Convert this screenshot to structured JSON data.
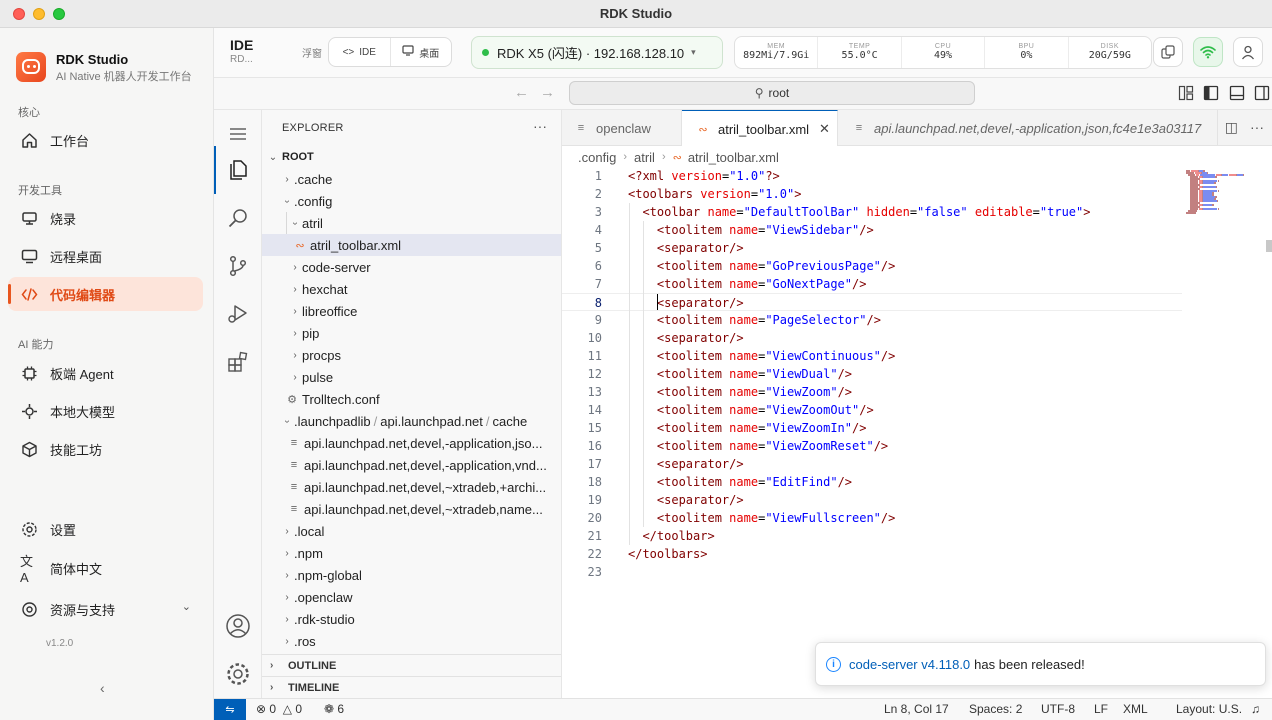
{
  "window": {
    "title": "RDK Studio"
  },
  "app": {
    "name": "RDK Studio",
    "subtitle": "AI Native 机器人开发工作台",
    "version": "v1.2.0"
  },
  "sidebar": {
    "sections": {
      "core": "核心",
      "dev_tools": "开发工具",
      "ai": "AI 能力"
    },
    "items": [
      {
        "label": "工作台",
        "icon": "home-icon"
      },
      {
        "label": "烧录",
        "icon": "flash-icon"
      },
      {
        "label": "远程桌面",
        "icon": "monitor-icon"
      },
      {
        "label": "代码编辑器",
        "icon": "code-icon",
        "active": true
      },
      {
        "label": "板端 Agent",
        "icon": "chip-icon"
      },
      {
        "label": "本地大模型",
        "icon": "sparkle-icon"
      },
      {
        "label": "技能工坊",
        "icon": "cube-icon"
      }
    ],
    "bottom": {
      "settings": "设置",
      "language": "简体中文",
      "resources": "资源与支持"
    }
  },
  "header": {
    "title": "IDE",
    "subtitle": "RD...",
    "float_label": "浮窗",
    "seg_ide": "IDE",
    "seg_desktop": "桌面",
    "device": "RDK X5 (闪连) · 192.168.128.10",
    "stats": [
      {
        "label": "MEM",
        "value": "892Mi/7.9Gi"
      },
      {
        "label": "TEMP",
        "value": "55.0°C"
      },
      {
        "label": "CPU",
        "value": "49%"
      },
      {
        "label": "BPU",
        "value": "0%"
      },
      {
        "label": "DISK",
        "value": "20G/59G"
      }
    ]
  },
  "search": {
    "value": "root"
  },
  "explorer": {
    "title": "EXPLORER",
    "root": "ROOT",
    "rows": [
      {
        "label": ".cache"
      },
      {
        "label": ".config"
      },
      {
        "label": "atril"
      },
      {
        "label": "atril_toolbar.xml"
      },
      {
        "label": "code-server"
      },
      {
        "label": "hexchat"
      },
      {
        "label": "libreoffice"
      },
      {
        "label": "pip"
      },
      {
        "label": "procps"
      },
      {
        "label": "pulse"
      },
      {
        "label": "Trolltech.conf"
      },
      {
        "label": ".launchpadlib",
        "label2": "api.launchpad.net",
        "label3": "cache"
      },
      {
        "label": "api.launchpad.net,devel,-application,jso..."
      },
      {
        "label": "api.launchpad.net,devel,-application,vnd..."
      },
      {
        "label": "api.launchpad.net,devel,~xtradeb,+archi..."
      },
      {
        "label": "api.launchpad.net,devel,~xtradeb,name..."
      },
      {
        "label": ".local"
      },
      {
        "label": ".npm"
      },
      {
        "label": ".npm-global"
      },
      {
        "label": ".openclaw"
      },
      {
        "label": ".rdk-studio"
      },
      {
        "label": ".ros"
      }
    ],
    "outline": "OUTLINE",
    "timeline": "TIMELINE"
  },
  "tabs": [
    {
      "label": "openclaw"
    },
    {
      "label": "atril_toolbar.xml",
      "active": true
    },
    {
      "label": "api.launchpad.net,devel,-application,json,fc4e1e3a03117"
    }
  ],
  "breadcrumb": [
    ".config",
    "atril",
    "atril_toolbar.xml"
  ],
  "code": {
    "lines": [
      [
        [
          "tg",
          "<?"
        ],
        [
          "tg",
          "xml"
        ],
        [
          "tx",
          " "
        ],
        [
          "at",
          "version"
        ],
        [
          "tx",
          "="
        ],
        [
          "st",
          "\"1.0\""
        ],
        [
          "tg",
          "?>"
        ]
      ],
      [
        [
          "tg",
          "<toolbars"
        ],
        [
          "tx",
          " "
        ],
        [
          "at",
          "version"
        ],
        [
          "tx",
          "="
        ],
        [
          "st",
          "\"1.0\""
        ],
        [
          "tg",
          ">"
        ]
      ],
      [
        [
          "tx",
          "  "
        ],
        [
          "tg",
          "<toolbar"
        ],
        [
          "tx",
          " "
        ],
        [
          "at",
          "name"
        ],
        [
          "tx",
          "="
        ],
        [
          "st",
          "\"DefaultToolBar\""
        ],
        [
          "tx",
          " "
        ],
        [
          "at",
          "hidden"
        ],
        [
          "tx",
          "="
        ],
        [
          "st",
          "\"false\""
        ],
        [
          "tx",
          " "
        ],
        [
          "at",
          "editable"
        ],
        [
          "tx",
          "="
        ],
        [
          "st",
          "\"true\""
        ],
        [
          "tg",
          ">"
        ]
      ],
      [
        [
          "tx",
          "    "
        ],
        [
          "tg",
          "<toolitem"
        ],
        [
          "tx",
          " "
        ],
        [
          "at",
          "name"
        ],
        [
          "tx",
          "="
        ],
        [
          "st",
          "\"ViewSidebar\""
        ],
        [
          "tg",
          "/>"
        ]
      ],
      [
        [
          "tx",
          "    "
        ],
        [
          "tg",
          "<separator/>"
        ]
      ],
      [
        [
          "tx",
          "    "
        ],
        [
          "tg",
          "<toolitem"
        ],
        [
          "tx",
          " "
        ],
        [
          "at",
          "name"
        ],
        [
          "tx",
          "="
        ],
        [
          "st",
          "\"GoPreviousPage\""
        ],
        [
          "tg",
          "/>"
        ]
      ],
      [
        [
          "tx",
          "    "
        ],
        [
          "tg",
          "<toolitem"
        ],
        [
          "tx",
          " "
        ],
        [
          "at",
          "name"
        ],
        [
          "tx",
          "="
        ],
        [
          "st",
          "\"GoNextPage\""
        ],
        [
          "tg",
          "/>"
        ]
      ],
      [
        [
          "tx",
          "    "
        ],
        [
          "tg",
          "<separator/>"
        ]
      ],
      [
        [
          "tx",
          "    "
        ],
        [
          "tg",
          "<toolitem"
        ],
        [
          "tx",
          " "
        ],
        [
          "at",
          "name"
        ],
        [
          "tx",
          "="
        ],
        [
          "st",
          "\"PageSelector\""
        ],
        [
          "tg",
          "/>"
        ]
      ],
      [
        [
          "tx",
          "    "
        ],
        [
          "tg",
          "<separator/>"
        ]
      ],
      [
        [
          "tx",
          "    "
        ],
        [
          "tg",
          "<toolitem"
        ],
        [
          "tx",
          " "
        ],
        [
          "at",
          "name"
        ],
        [
          "tx",
          "="
        ],
        [
          "st",
          "\"ViewContinuous\""
        ],
        [
          "tg",
          "/>"
        ]
      ],
      [
        [
          "tx",
          "    "
        ],
        [
          "tg",
          "<toolitem"
        ],
        [
          "tx",
          " "
        ],
        [
          "at",
          "name"
        ],
        [
          "tx",
          "="
        ],
        [
          "st",
          "\"ViewDual\""
        ],
        [
          "tg",
          "/>"
        ]
      ],
      [
        [
          "tx",
          "    "
        ],
        [
          "tg",
          "<toolitem"
        ],
        [
          "tx",
          " "
        ],
        [
          "at",
          "name"
        ],
        [
          "tx",
          "="
        ],
        [
          "st",
          "\"ViewZoom\""
        ],
        [
          "tg",
          "/>"
        ]
      ],
      [
        [
          "tx",
          "    "
        ],
        [
          "tg",
          "<toolitem"
        ],
        [
          "tx",
          " "
        ],
        [
          "at",
          "name"
        ],
        [
          "tx",
          "="
        ],
        [
          "st",
          "\"ViewZoomOut\""
        ],
        [
          "tg",
          "/>"
        ]
      ],
      [
        [
          "tx",
          "    "
        ],
        [
          "tg",
          "<toolitem"
        ],
        [
          "tx",
          " "
        ],
        [
          "at",
          "name"
        ],
        [
          "tx",
          "="
        ],
        [
          "st",
          "\"ViewZoomIn\""
        ],
        [
          "tg",
          "/>"
        ]
      ],
      [
        [
          "tx",
          "    "
        ],
        [
          "tg",
          "<toolitem"
        ],
        [
          "tx",
          " "
        ],
        [
          "at",
          "name"
        ],
        [
          "tx",
          "="
        ],
        [
          "st",
          "\"ViewZoomReset\""
        ],
        [
          "tg",
          "/>"
        ]
      ],
      [
        [
          "tx",
          "    "
        ],
        [
          "tg",
          "<separator/>"
        ]
      ],
      [
        [
          "tx",
          "    "
        ],
        [
          "tg",
          "<toolitem"
        ],
        [
          "tx",
          " "
        ],
        [
          "at",
          "name"
        ],
        [
          "tx",
          "="
        ],
        [
          "st",
          "\"EditFind\""
        ],
        [
          "tg",
          "/>"
        ]
      ],
      [
        [
          "tx",
          "    "
        ],
        [
          "tg",
          "<separator/>"
        ]
      ],
      [
        [
          "tx",
          "    "
        ],
        [
          "tg",
          "<toolitem"
        ],
        [
          "tx",
          " "
        ],
        [
          "at",
          "name"
        ],
        [
          "tx",
          "="
        ],
        [
          "st",
          "\"ViewFullscreen\""
        ],
        [
          "tg",
          "/>"
        ]
      ],
      [
        [
          "tx",
          "  "
        ],
        [
          "tg",
          "</toolbar>"
        ]
      ],
      [
        [
          "tg",
          "</toolbars>"
        ]
      ],
      []
    ],
    "cursor_line": 8
  },
  "notification": {
    "link": "code-server v4.118.0",
    "text": "has been released!"
  },
  "status": {
    "errors": "0",
    "warnings": "0",
    "ports": "6",
    "position": "Ln 8, Col 17",
    "spaces": "Spaces: 2",
    "encoding": "UTF-8",
    "eol": "LF",
    "language": "XML",
    "layout": "Layout: U.S."
  },
  "colors": {
    "accent": "#e8561f",
    "vscode_blue": "#005fb8",
    "online": "#2fbd4a"
  }
}
